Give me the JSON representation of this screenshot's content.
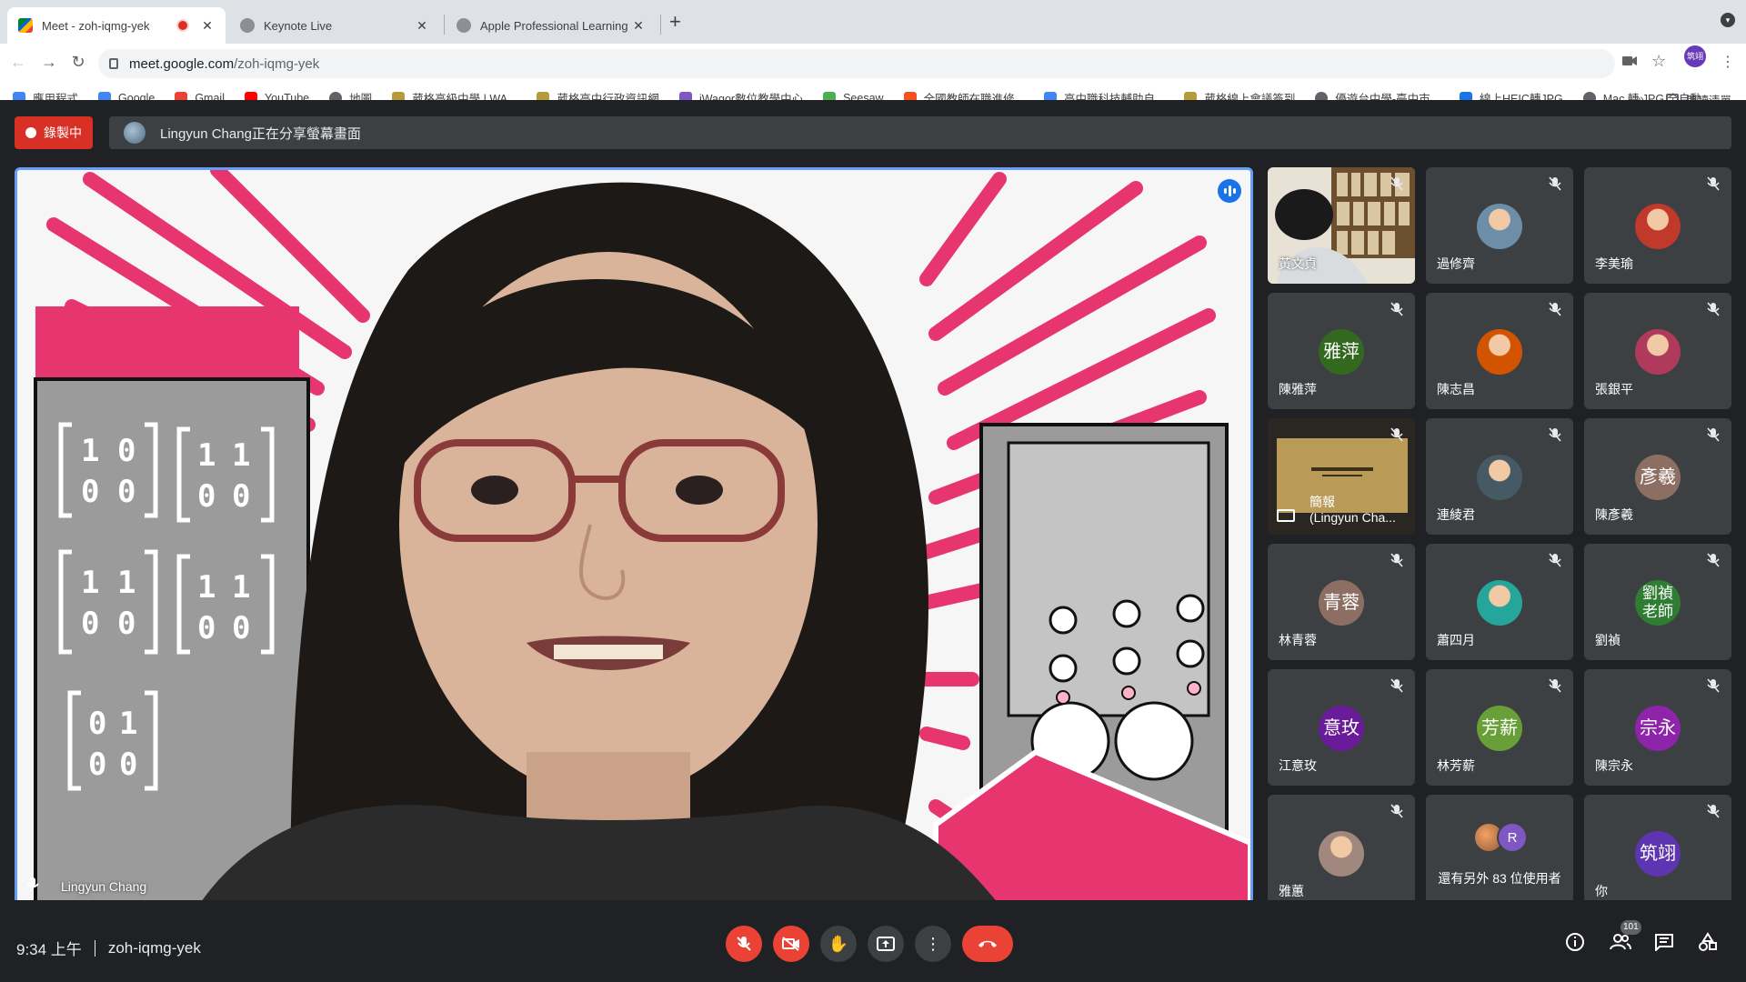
{
  "browser": {
    "tabs": [
      {
        "title": "Meet - zoh-iqmg-yek",
        "active": true,
        "recording": true
      },
      {
        "title": "Keynote Live",
        "active": false
      },
      {
        "title": "Apple Professional Learning Vi",
        "active": false
      }
    ],
    "url_host": "meet.google.com",
    "url_path": "/zoh-iqmg-yek",
    "profile_initials": "筑翊",
    "bookmarks": [
      {
        "label": "應用程式",
        "icon": "apps-grid-icon",
        "color": "#4285f4"
      },
      {
        "label": "Google",
        "icon": "google-icon",
        "color": "#4285f4"
      },
      {
        "label": "Gmail",
        "icon": "gmail-icon",
        "color": "#ea4335"
      },
      {
        "label": "YouTube",
        "icon": "youtube-icon",
        "color": "#ff0000"
      },
      {
        "label": "地圖",
        "icon": "globe-icon",
        "color": "#5f6368"
      },
      {
        "label": "葳格高級中學 | WA...",
        "icon": "school-crest-icon",
        "color": "#b59b3a"
      },
      {
        "label": "葳格高中行政資訊網",
        "icon": "school-crest-icon",
        "color": "#b59b3a"
      },
      {
        "label": "iWagor數位教學中心",
        "icon": "iwagor-icon",
        "color": "#7e57c2"
      },
      {
        "label": "Seesaw",
        "icon": "seesaw-icon",
        "color": "#4caf50"
      },
      {
        "label": "全國教師在職進修...",
        "icon": "teacher-icon",
        "color": "#f4511e"
      },
      {
        "label": "高中職科技輔助自...",
        "icon": "doc-icon",
        "color": "#4285f4"
      },
      {
        "label": "葳格線上會議簽到",
        "icon": "school-crest-icon",
        "color": "#b59b3a"
      },
      {
        "label": "優遊台中學-臺中市...",
        "icon": "globe-icon",
        "color": "#5f6368"
      },
      {
        "label": "線上HEIC轉JPG",
        "icon": "heic-icon",
        "color": "#1a73e8"
      },
      {
        "label": "Mac 轉 JPG 全自動",
        "icon": "globe-icon",
        "color": "#5f6368"
      }
    ],
    "bookmarks_more": "»",
    "reading_list": "閱讀清單"
  },
  "meet": {
    "recording_label": "錄製中",
    "share_banner": "Lingyun Chang正在分享螢幕畫面",
    "main_speaker": "Lingyun Chang",
    "participants": [
      {
        "name": "黃文貞",
        "type": "video"
      },
      {
        "name": "過修齊",
        "type": "photo",
        "color": "#6d8ea8"
      },
      {
        "name": "李美瑜",
        "type": "photo",
        "color": "#c0392b"
      },
      {
        "name": "陳雅萍",
        "type": "initials",
        "initials": "雅萍",
        "color": "#33691e"
      },
      {
        "name": "陳志昌",
        "type": "photo",
        "color": "#d35400"
      },
      {
        "name": "張銀平",
        "type": "photo",
        "color": "#b03a5b"
      },
      {
        "name": "簡報\n(Lingyun Cha...",
        "type": "presentation"
      },
      {
        "name": "連綾君",
        "type": "photo",
        "color": "#455a64"
      },
      {
        "name": "陳彥羲",
        "type": "initials",
        "initials": "彥羲",
        "color": "#8d6e63"
      },
      {
        "name": "林青蓉",
        "type": "initials",
        "initials": "青蓉",
        "color": "#8d6e63"
      },
      {
        "name": "蕭四月",
        "type": "photo",
        "color": "#26a69a"
      },
      {
        "name": "劉禎",
        "type": "initials",
        "initials": "劉禎\n老師",
        "color": "#2e7d32"
      },
      {
        "name": "江意玫",
        "type": "initials",
        "initials": "意玫",
        "color": "#6a1b9a"
      },
      {
        "name": "林芳薪",
        "type": "initials",
        "initials": "芳薪",
        "color": "#689f38"
      },
      {
        "name": "陳宗永",
        "type": "initials",
        "initials": "宗永",
        "color": "#8e24aa"
      },
      {
        "name": "雅蕙",
        "type": "photo",
        "color": "#a1887f"
      },
      {
        "name": "還有另外 83 位使用者",
        "type": "more",
        "extra_initial": "R"
      },
      {
        "name": "你",
        "type": "initials",
        "initials": "筑翊",
        "color": "#5e35b1"
      }
    ],
    "time": "9:34 上午",
    "meeting_code": "zoh-iqmg-yek",
    "participant_count": "101"
  },
  "colors": {
    "accent_blue": "#669df6",
    "danger_red": "#ea4335",
    "background": "#202124",
    "tile": "#3c4043"
  }
}
